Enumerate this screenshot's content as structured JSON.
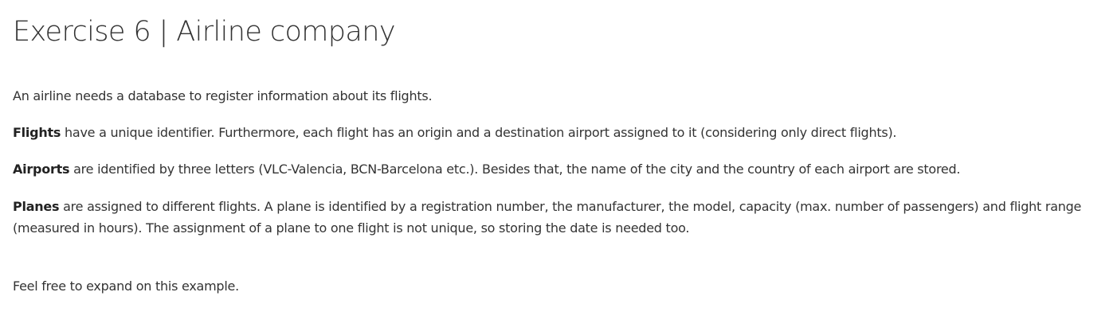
{
  "document": {
    "title": "Exercise 6 | Airline company",
    "intro": "An airline needs a database to register information about its flights.",
    "flights": {
      "term": "Flights",
      "text": " have a unique identifier. Furthermore, each flight has an origin and a destination airport assigned to it (considering only direct flights)."
    },
    "airports": {
      "term": "Airports",
      "text": " are identified by three letters (VLC-Valencia, BCN-Barcelona etc.). Besides that, the name of the city and the country of each airport are stored."
    },
    "planes": {
      "term": "Planes",
      "text": " are assigned to different flights. A plane is identified by a registration number, the manufacturer, the model, capacity (max. number of passengers) and flight range (measured in hours). The assignment of a plane to one flight is not unique, so storing the date is needed too."
    },
    "closing": "Feel free to expand on this example."
  }
}
